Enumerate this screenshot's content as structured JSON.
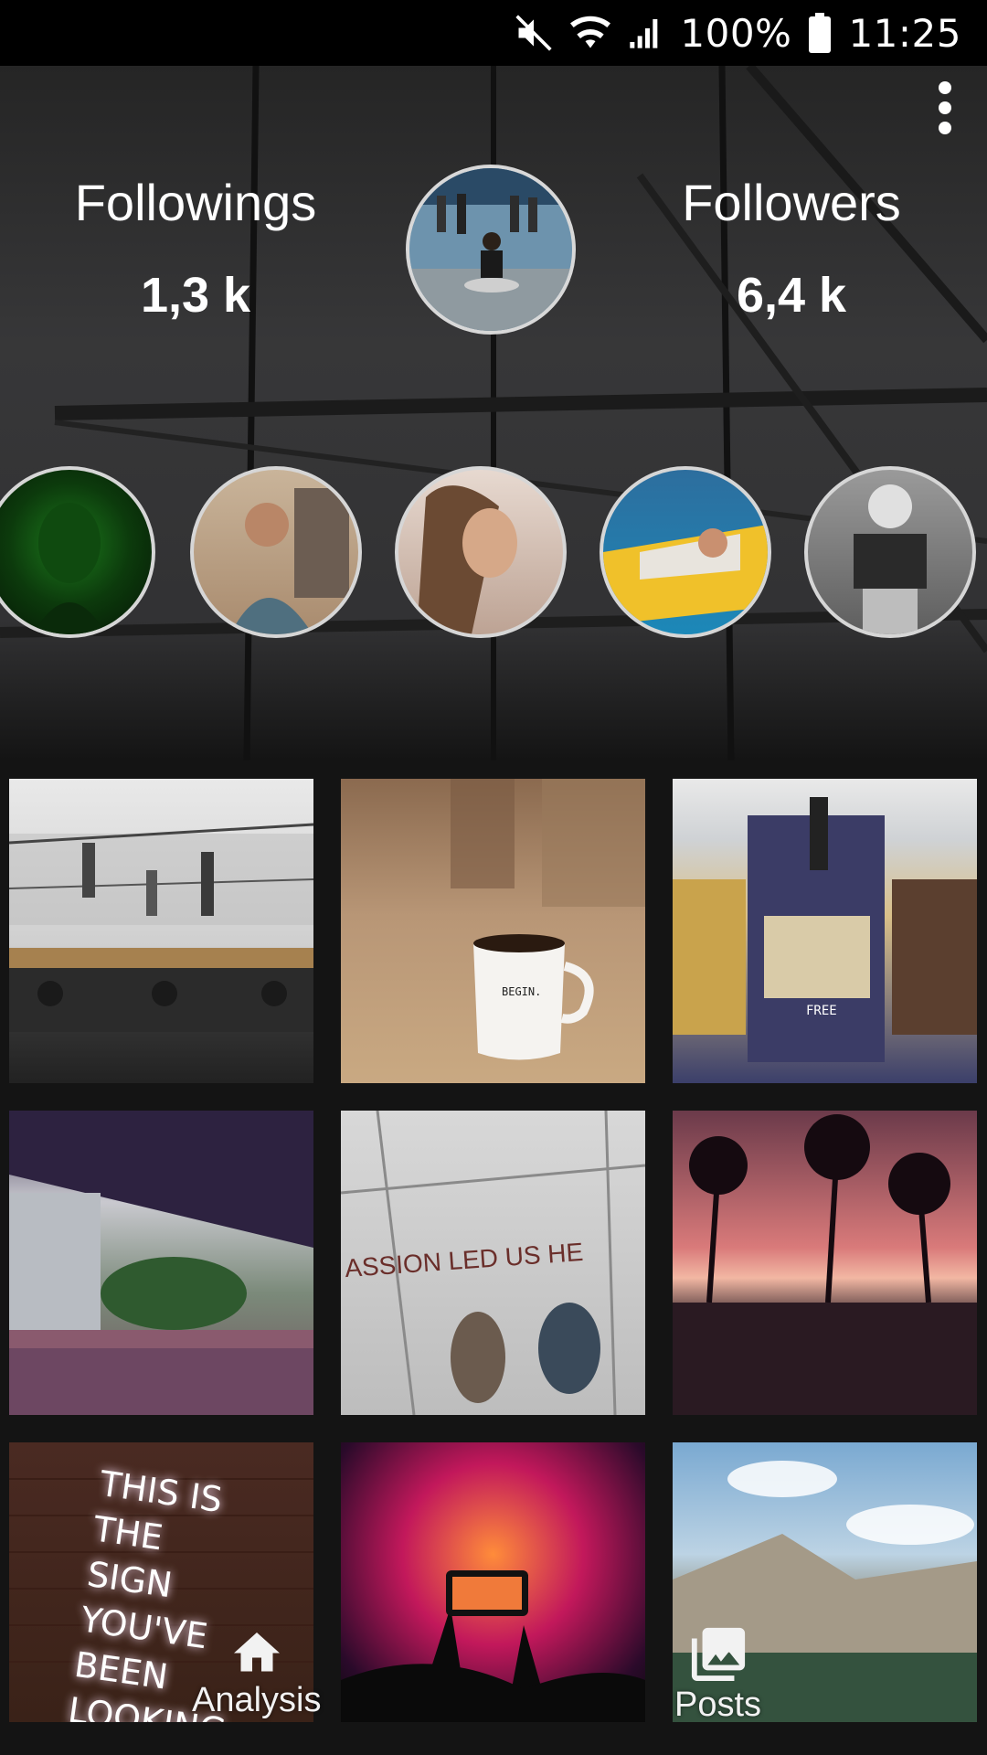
{
  "status_bar": {
    "battery": "100%",
    "time": "11:25",
    "icons": [
      "mute-icon",
      "wifi-icon",
      "signal-icon",
      "battery-icon"
    ]
  },
  "header": {
    "menu_icon": "more-vert-icon",
    "followings": {
      "label": "Followings",
      "value": "1,3 k"
    },
    "followers": {
      "label": "Followers",
      "value": "6,4 k"
    }
  },
  "stories": [
    {
      "name": "story-1",
      "color": "#1c5a1c"
    },
    {
      "name": "story-2",
      "color": "#4b6c82"
    },
    {
      "name": "story-3",
      "color": "#7a5a46"
    },
    {
      "name": "story-4",
      "color": "#e8b930"
    },
    {
      "name": "story-5",
      "color": "#8a8a8a"
    }
  ],
  "posts": [
    {
      "id": "post-bridge",
      "caption": ""
    },
    {
      "id": "post-coffee",
      "caption": "BEGIN."
    },
    {
      "id": "post-newspaper",
      "caption": "FREE"
    },
    {
      "id": "post-crowd",
      "caption": ""
    },
    {
      "id": "post-sidewalk",
      "caption": "ASSION LED US HE"
    },
    {
      "id": "post-palms",
      "caption": ""
    },
    {
      "id": "post-neon",
      "caption": "THIS IS THE SIGN YOU'VE BEEN LOOKING FOR"
    },
    {
      "id": "post-concert",
      "caption": ""
    },
    {
      "id": "post-mountains",
      "caption": ""
    }
  ],
  "bottom_nav": {
    "analysis": {
      "label": "Analysis",
      "icon": "home-icon"
    },
    "posts": {
      "label": "Posts",
      "icon": "photo-library-icon"
    }
  }
}
